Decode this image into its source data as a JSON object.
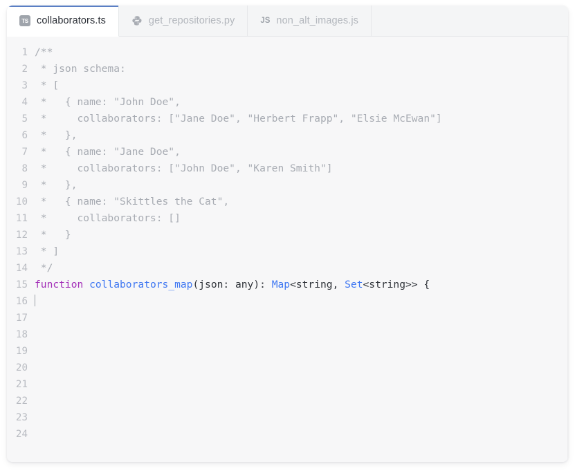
{
  "window": {
    "accent_color": "#5b7fc4",
    "background": "#f7f7f8"
  },
  "tabs": [
    {
      "label": "collaborators.ts",
      "icon": "typescript-icon",
      "icon_text": "TS",
      "active": true
    },
    {
      "label": "get_repositories.py",
      "icon": "python-icon",
      "icon_text": "",
      "active": false
    },
    {
      "label": "non_alt_images.js",
      "icon": "javascript-icon",
      "icon_text": "JS",
      "active": false
    }
  ],
  "editor": {
    "language": "typescript",
    "cursor_line": 16,
    "cursor_column": 1,
    "total_lines": 24,
    "lines": [
      {
        "number": "1",
        "tokens": [
          {
            "t": "/**",
            "c": "comment"
          }
        ]
      },
      {
        "number": "2",
        "tokens": [
          {
            "t": " * json schema:",
            "c": "comment"
          }
        ]
      },
      {
        "number": "3",
        "tokens": [
          {
            "t": " * [",
            "c": "comment"
          }
        ]
      },
      {
        "number": "4",
        "tokens": [
          {
            "t": " *   { name: \"John Doe\",",
            "c": "comment"
          }
        ]
      },
      {
        "number": "5",
        "tokens": [
          {
            "t": " *     collaborators: [\"Jane Doe\", \"Herbert Frapp\", \"Elsie McEwan\"]",
            "c": "comment"
          }
        ]
      },
      {
        "number": "6",
        "tokens": [
          {
            "t": " *   },",
            "c": "comment"
          }
        ]
      },
      {
        "number": "7",
        "tokens": [
          {
            "t": " *   { name: \"Jane Doe\",",
            "c": "comment"
          }
        ]
      },
      {
        "number": "8",
        "tokens": [
          {
            "t": " *     collaborators: [\"John Doe\", \"Karen Smith\"]",
            "c": "comment"
          }
        ]
      },
      {
        "number": "9",
        "tokens": [
          {
            "t": " *   },",
            "c": "comment"
          }
        ]
      },
      {
        "number": "10",
        "tokens": [
          {
            "t": " *   { name: \"Skittles the Cat\",",
            "c": "comment"
          }
        ]
      },
      {
        "number": "11",
        "tokens": [
          {
            "t": " *     collaborators: []",
            "c": "comment"
          }
        ]
      },
      {
        "number": "12",
        "tokens": [
          {
            "t": " *   }",
            "c": "comment"
          }
        ]
      },
      {
        "number": "13",
        "tokens": [
          {
            "t": " * ]",
            "c": "comment"
          }
        ]
      },
      {
        "number": "14",
        "tokens": [
          {
            "t": " */",
            "c": "comment"
          }
        ]
      },
      {
        "number": "15",
        "tokens": [
          {
            "t": "function",
            "c": "keyword"
          },
          {
            "t": " ",
            "c": "plain"
          },
          {
            "t": "collaborators_map",
            "c": "func"
          },
          {
            "t": "(json: any): ",
            "c": "plain"
          },
          {
            "t": "Map",
            "c": "type"
          },
          {
            "t": "<string, ",
            "c": "plain"
          },
          {
            "t": "Set",
            "c": "type"
          },
          {
            "t": "<string>> {",
            "c": "plain"
          }
        ]
      },
      {
        "number": "16",
        "tokens": [],
        "caret": true
      },
      {
        "number": "17",
        "tokens": []
      },
      {
        "number": "18",
        "tokens": []
      },
      {
        "number": "19",
        "tokens": []
      },
      {
        "number": "20",
        "tokens": []
      },
      {
        "number": "21",
        "tokens": []
      },
      {
        "number": "22",
        "tokens": []
      },
      {
        "number": "23",
        "tokens": []
      },
      {
        "number": "24",
        "tokens": []
      }
    ]
  }
}
